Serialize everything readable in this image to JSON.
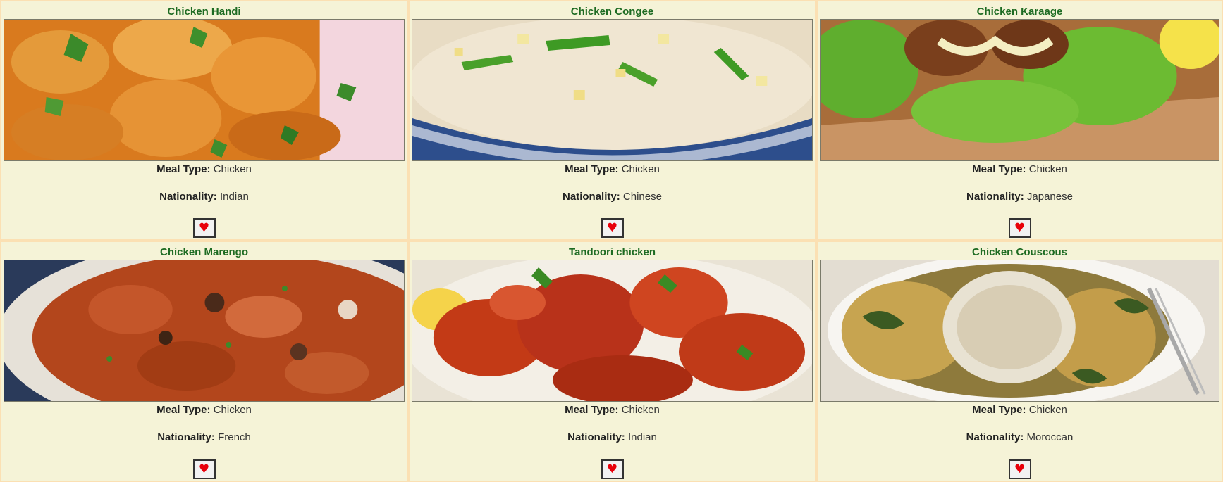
{
  "meal_type_label": "Meal Type:",
  "nationality_label": "Nationality:",
  "favorite_icon": "heart-icon",
  "accent_color": "#1d6b22",
  "heart_color": "#e8000b",
  "meals": [
    {
      "name": "Chicken Handi",
      "meal_type": "Chicken",
      "nationality": "Indian"
    },
    {
      "name": "Chicken Congee",
      "meal_type": "Chicken",
      "nationality": "Chinese"
    },
    {
      "name": "Chicken Karaage",
      "meal_type": "Chicken",
      "nationality": "Japanese"
    },
    {
      "name": "Chicken Marengo",
      "meal_type": "Chicken",
      "nationality": "French"
    },
    {
      "name": "Tandoori chicken",
      "meal_type": "Chicken",
      "nationality": "Indian"
    },
    {
      "name": "Chicken Couscous",
      "meal_type": "Chicken",
      "nationality": "Moroccan"
    }
  ]
}
